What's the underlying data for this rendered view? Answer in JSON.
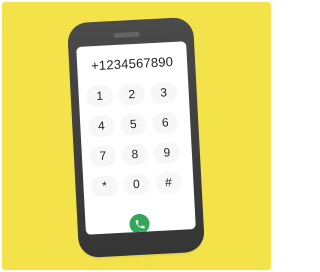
{
  "colors": {
    "background": "#f4e24b",
    "phone_body": "#4a4a4a",
    "phone_edge": "#353535",
    "screen": "#ffffff",
    "key_bg": "#f7f7f7",
    "key_text": "#222222",
    "number_text": "#1f1f1f",
    "call_button": "#33a65a",
    "call_icon": "#ffffff",
    "speaker": "#777777"
  },
  "phone": {
    "dialed_number": "+1234567890",
    "keys": [
      "1",
      "2",
      "3",
      "4",
      "5",
      "6",
      "7",
      "8",
      "9",
      "*",
      "0",
      "#"
    ],
    "call_icon": "phone-icon"
  }
}
